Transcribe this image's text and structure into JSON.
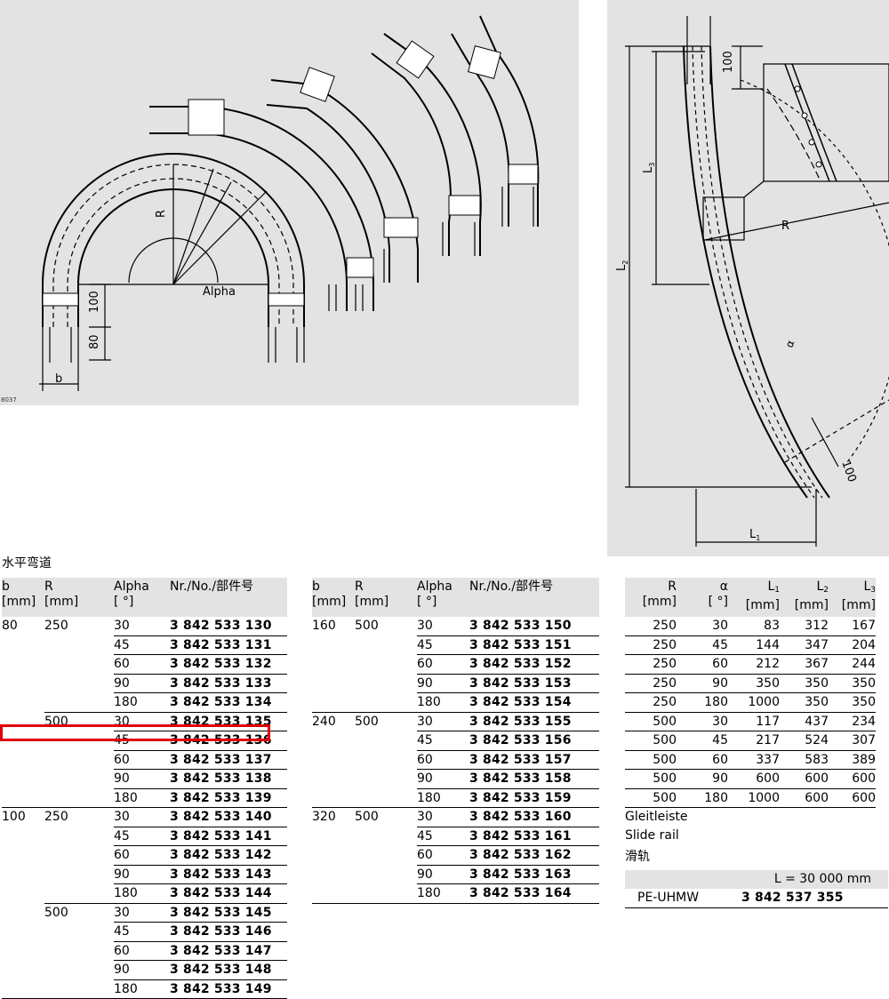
{
  "figure": {
    "code": "8037",
    "label_R": "R",
    "label_alpha": "Alpha",
    "dim_100": "100",
    "dim_80": "80",
    "label_b": "b"
  },
  "side_figure": {
    "dim_100_top": "100",
    "label_L3": "L",
    "label_L3_sub": "3",
    "label_L2": "L",
    "label_L2_sub": "2",
    "label_R": "R",
    "label_alpha": "α",
    "dim_100_bottom": "100",
    "label_L1": "L",
    "label_L1_sub": "1"
  },
  "section_title": "水平弯道",
  "table_headers": {
    "b": "b",
    "b_unit": "[mm]",
    "r": "R",
    "r_unit": "[mm]",
    "alpha": "Alpha",
    "alpha_unit": "[ °]",
    "nr": "Nr./No./部件号"
  },
  "table1": [
    {
      "b": "80",
      "r": "250",
      "alpha": "30",
      "nr": "3 842 533 130"
    },
    {
      "b": "",
      "r": "",
      "alpha": "45",
      "nr": "3 842 533 131"
    },
    {
      "b": "",
      "r": "",
      "alpha": "60",
      "nr": "3 842 533 132"
    },
    {
      "b": "",
      "r": "",
      "alpha": "90",
      "nr": "3 842 533 133"
    },
    {
      "b": "",
      "r": "",
      "alpha": "180",
      "nr": "3 842 533 134"
    },
    {
      "b": "",
      "r": "500",
      "alpha": "30",
      "nr": "3 842 533 135"
    },
    {
      "b": "",
      "r": "",
      "alpha": "45",
      "nr": "3 842 533 136"
    },
    {
      "b": "",
      "r": "",
      "alpha": "60",
      "nr": "3 842 533 137"
    },
    {
      "b": "",
      "r": "",
      "alpha": "90",
      "nr": "3 842 533 138"
    },
    {
      "b": "",
      "r": "",
      "alpha": "180",
      "nr": "3 842 533 139"
    },
    {
      "b": "100",
      "r": "250",
      "alpha": "30",
      "nr": "3 842 533 140"
    },
    {
      "b": "",
      "r": "",
      "alpha": "45",
      "nr": "3 842 533 141"
    },
    {
      "b": "",
      "r": "",
      "alpha": "60",
      "nr": "3 842 533 142"
    },
    {
      "b": "",
      "r": "",
      "alpha": "90",
      "nr": "3 842 533 143"
    },
    {
      "b": "",
      "r": "",
      "alpha": "180",
      "nr": "3 842 533 144"
    },
    {
      "b": "",
      "r": "500",
      "alpha": "30",
      "nr": "3 842 533 145"
    },
    {
      "b": "",
      "r": "",
      "alpha": "45",
      "nr": "3 842 533 146"
    },
    {
      "b": "",
      "r": "",
      "alpha": "60",
      "nr": "3 842 533 147"
    },
    {
      "b": "",
      "r": "",
      "alpha": "90",
      "nr": "3 842 533 148"
    },
    {
      "b": "",
      "r": "",
      "alpha": "180",
      "nr": "3 842 533 149"
    }
  ],
  "table2": [
    {
      "b": "160",
      "r": "500",
      "alpha": "30",
      "nr": "3 842 533 150"
    },
    {
      "b": "",
      "r": "",
      "alpha": "45",
      "nr": "3 842 533 151"
    },
    {
      "b": "",
      "r": "",
      "alpha": "60",
      "nr": "3 842 533 152"
    },
    {
      "b": "",
      "r": "",
      "alpha": "90",
      "nr": "3 842 533 153"
    },
    {
      "b": "",
      "r": "",
      "alpha": "180",
      "nr": "3 842 533 154"
    },
    {
      "b": "240",
      "r": "500",
      "alpha": "30",
      "nr": "3 842 533 155"
    },
    {
      "b": "",
      "r": "",
      "alpha": "45",
      "nr": "3 842 533 156"
    },
    {
      "b": "",
      "r": "",
      "alpha": "60",
      "nr": "3 842 533 157"
    },
    {
      "b": "",
      "r": "",
      "alpha": "90",
      "nr": "3 842 533 158"
    },
    {
      "b": "",
      "r": "",
      "alpha": "180",
      "nr": "3 842 533 159"
    },
    {
      "b": "320",
      "r": "500",
      "alpha": "30",
      "nr": "3 842 533 160"
    },
    {
      "b": "",
      "r": "",
      "alpha": "45",
      "nr": "3 842 533 161"
    },
    {
      "b": "",
      "r": "",
      "alpha": "60",
      "nr": "3 842 533 162"
    },
    {
      "b": "",
      "r": "",
      "alpha": "90",
      "nr": "3 842 533 163"
    },
    {
      "b": "",
      "r": "",
      "alpha": "180",
      "nr": "3 842 533 164"
    }
  ],
  "table3_headers": {
    "r": "R",
    "a": "α",
    "l1": "L",
    "l1_sub": "1",
    "l2": "L",
    "l2_sub": "2",
    "l3": "L",
    "l3_sub": "3",
    "unit_mm": "[mm]",
    "unit_deg": "[ °]"
  },
  "table3": [
    {
      "r": "250",
      "a": "30",
      "l1": "83",
      "l2": "312",
      "l3": "167"
    },
    {
      "r": "250",
      "a": "45",
      "l1": "144",
      "l2": "347",
      "l3": "204"
    },
    {
      "r": "250",
      "a": "60",
      "l1": "212",
      "l2": "367",
      "l3": "244"
    },
    {
      "r": "250",
      "a": "90",
      "l1": "350",
      "l2": "350",
      "l3": "350"
    },
    {
      "r": "250",
      "a": "180",
      "l1": "1000",
      "l2": "350",
      "l3": "350"
    },
    {
      "r": "500",
      "a": "30",
      "l1": "117",
      "l2": "437",
      "l3": "234"
    },
    {
      "r": "500",
      "a": "45",
      "l1": "217",
      "l2": "524",
      "l3": "307"
    },
    {
      "r": "500",
      "a": "60",
      "l1": "337",
      "l2": "583",
      "l3": "389"
    },
    {
      "r": "500",
      "a": "90",
      "l1": "600",
      "l2": "600",
      "l3": "600"
    },
    {
      "r": "500",
      "a": "180",
      "l1": "1000",
      "l2": "600",
      "l3": "600"
    }
  ],
  "slide_rail": {
    "de": "Gleitleiste",
    "en": "Slide rail",
    "zh": "滑轨",
    "length": "L = 30 000 mm",
    "material": "PE-UHMW",
    "nr": "3 842 537 355"
  }
}
